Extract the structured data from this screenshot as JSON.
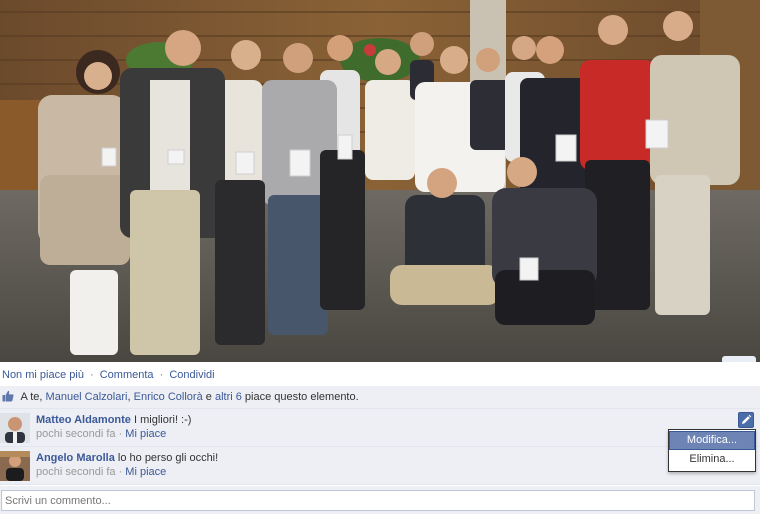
{
  "photo": {
    "icon": "group-photo"
  },
  "actions": {
    "unlike": "Non mi piace più",
    "comment": "Commenta",
    "share": "Condividi",
    "separator": "·"
  },
  "likes": {
    "prefix": "A te,",
    "person1": "Manuel Calzolari",
    "comma": ",",
    "person2": "Enrico Collorà",
    "and_word": "e",
    "others": "altri 6",
    "suffix": "piace questo elemento."
  },
  "comments": [
    {
      "author": "Matteo Aldamonte",
      "text": "I migliori! :-)",
      "time": "pochi secondi fa",
      "dot": "·",
      "like": "Mi piace"
    },
    {
      "author": "Angelo Marolla",
      "text": "lo ho perso gli occhi!",
      "time": "pochi secondi fa",
      "dot": "·",
      "like": "Mi piace"
    }
  ],
  "menu": {
    "edit": "Modifica...",
    "delete": "Elimina..."
  },
  "comment_box": {
    "placeholder": "Scrivi un commento..."
  },
  "colors": {
    "link": "#3b5998",
    "feedback_bg": "#edeff4",
    "menu_highlight": "#6d84b4"
  }
}
